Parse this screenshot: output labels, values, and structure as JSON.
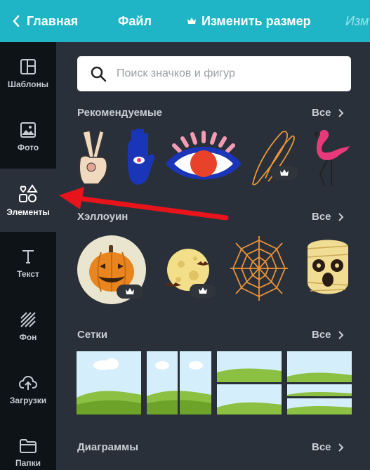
{
  "topbar": {
    "back_label": "Главная",
    "file_label": "Файл",
    "resize_label": "Изменить размер",
    "ghost_label": "Изм"
  },
  "sidebar": {
    "items": [
      {
        "label": "Шаблоны",
        "icon": "templates-icon"
      },
      {
        "label": "Фото",
        "icon": "photo-icon"
      },
      {
        "label": "Элементы",
        "icon": "elements-icon"
      },
      {
        "label": "Текст",
        "icon": "text-icon"
      },
      {
        "label": "Фон",
        "icon": "background-icon"
      },
      {
        "label": "Загрузки",
        "icon": "upload-icon"
      },
      {
        "label": "Папки",
        "icon": "folder-icon"
      }
    ],
    "active": "Элементы"
  },
  "search": {
    "placeholder": "Поиск значков и фигур"
  },
  "sections": [
    {
      "title": "Рекомендуемые",
      "all_label": "Все"
    },
    {
      "title": "Хэллоуин",
      "all_label": "Все"
    },
    {
      "title": "Сетки",
      "all_label": "Все"
    },
    {
      "title": "Диаграммы",
      "all_label": "Все"
    }
  ],
  "colors": {
    "topbar": "#1fb5c6",
    "sidebar": "#0e1318",
    "panel": "#293039",
    "arrow": "#e8141b"
  }
}
